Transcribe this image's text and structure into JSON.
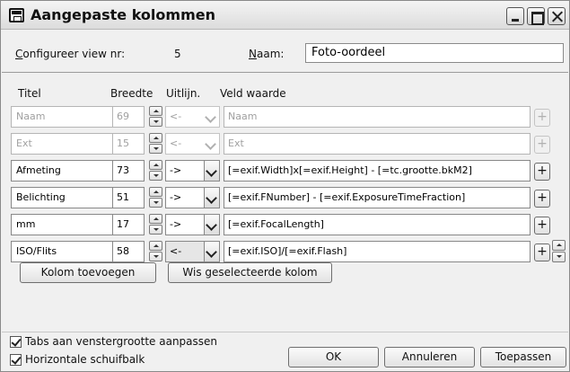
{
  "window": {
    "title": "Aangepaste kolommen",
    "icon": "save-disk-icon"
  },
  "header": {
    "view_label": "Configureer view nr:",
    "view_number": "5",
    "name_label": "Naam:",
    "name_value": "Foto-oordeel"
  },
  "columns_header": {
    "title": "Titel",
    "width": "Breedte",
    "align": "Uitlijn.",
    "field": "Veld waarde"
  },
  "rows": [
    {
      "title": "Naam",
      "width": "69",
      "align": "<-",
      "field": "Naam",
      "enabled": false
    },
    {
      "title": "Ext",
      "width": "15",
      "align": "<-",
      "field": "Ext",
      "enabled": false
    },
    {
      "title": "Afmeting",
      "width": "73",
      "align": "->",
      "field": "[=exif.Width]x[=exif.Height] - [=tc.grootte.bkM2]",
      "enabled": true
    },
    {
      "title": "Belichting",
      "width": "51",
      "align": "->",
      "field": "[=exif.FNumber] - [=exif.ExposureTimeFraction]",
      "enabled": true
    },
    {
      "title": "mm",
      "width": "17",
      "align": "->",
      "field": "[=exif.FocalLength]",
      "enabled": true
    },
    {
      "title": "ISO/Flits",
      "width": "58",
      "align": "<-",
      "field": "[=exif.ISO]/[=exif.Flash]",
      "enabled": true
    }
  ],
  "plus_label": "+",
  "buttons": {
    "add_column": "Kolom toevoegen",
    "delete_column": "Wis geselecteerde kolom",
    "ok": "OK",
    "cancel": "Annuleren",
    "apply": "Toepassen"
  },
  "options": {
    "tabs_fit": {
      "label": "Tabs aan venstergrootte aanpassen",
      "checked": true
    },
    "hscroll": {
      "label": "Horizontale schuifbalk",
      "checked": true
    }
  }
}
